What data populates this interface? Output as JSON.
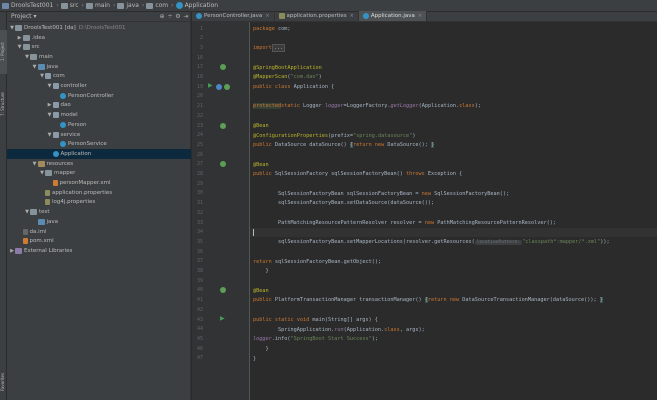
{
  "navbar": {
    "crumbs": [
      {
        "label": "DroolsTest001",
        "icon": "project-icon"
      },
      {
        "label": "src",
        "icon": "folder-icon"
      },
      {
        "label": "main",
        "icon": "folder-icon"
      },
      {
        "label": "java",
        "icon": "folder-icon"
      },
      {
        "label": "com",
        "icon": "folder-icon"
      },
      {
        "label": "Application",
        "icon": "class-icon"
      }
    ]
  },
  "left_strip": {
    "tabs": [
      {
        "label": "1: Project"
      },
      {
        "label": "7: Structure"
      },
      {
        "label": "Favorites"
      }
    ]
  },
  "project_panel": {
    "title": "Project",
    "dropdown_icon": "chevron-down-icon",
    "tools": [
      "⊕",
      "÷",
      "⚙",
      "⇥"
    ],
    "tree": [
      {
        "label": "DroolsTest001 [da]",
        "dim": "D:\\DroolsTest001",
        "depth": 0,
        "arrow": "▼",
        "icon": "folder"
      },
      {
        "label": ".idea",
        "depth": 1,
        "arrow": "▶",
        "icon": "folder"
      },
      {
        "label": "src",
        "depth": 1,
        "arrow": "▼",
        "icon": "folder"
      },
      {
        "label": "main",
        "depth": 2,
        "arrow": "▼",
        "icon": "folder"
      },
      {
        "label": "java",
        "depth": 3,
        "arrow": "▼",
        "icon": "src"
      },
      {
        "label": "com",
        "depth": 4,
        "arrow": "▼",
        "icon": "pkg"
      },
      {
        "label": "controller",
        "depth": 5,
        "arrow": "▼",
        "icon": "pkg"
      },
      {
        "label": "PersonController",
        "depth": 6,
        "arrow": "",
        "icon": "cls"
      },
      {
        "label": "dao",
        "depth": 5,
        "arrow": "▶",
        "icon": "pkg"
      },
      {
        "label": "model",
        "depth": 5,
        "arrow": "▼",
        "icon": "pkg"
      },
      {
        "label": "Person",
        "depth": 6,
        "arrow": "",
        "icon": "cls"
      },
      {
        "label": "service",
        "depth": 5,
        "arrow": "▼",
        "icon": "pkg"
      },
      {
        "label": "PersonService",
        "depth": 6,
        "arrow": "",
        "icon": "cls"
      },
      {
        "label": "Application",
        "depth": 5,
        "arrow": "",
        "icon": "cls",
        "selected": true
      },
      {
        "label": "resources",
        "depth": 3,
        "arrow": "▼",
        "icon": "res"
      },
      {
        "label": "mapper",
        "depth": 4,
        "arrow": "▼",
        "icon": "folder"
      },
      {
        "label": "personMapper.xml",
        "depth": 5,
        "arrow": "",
        "icon": "xml"
      },
      {
        "label": "application.properties",
        "depth": 4,
        "arrow": "",
        "icon": "props"
      },
      {
        "label": "log4j.properties",
        "depth": 4,
        "arrow": "",
        "icon": "props"
      },
      {
        "label": "test",
        "depth": 2,
        "arrow": "▼",
        "icon": "folder"
      },
      {
        "label": "java",
        "depth": 3,
        "arrow": "",
        "icon": "src"
      },
      {
        "label": "da.iml",
        "depth": 1,
        "arrow": "",
        "icon": "iml"
      },
      {
        "label": "pom.xml",
        "depth": 1,
        "arrow": "",
        "icon": "xml"
      },
      {
        "label": "External Libraries",
        "depth": 0,
        "arrow": "▶",
        "icon": "lib"
      }
    ]
  },
  "editor": {
    "tabs": [
      {
        "label": "PersonController.java",
        "icon": "class",
        "active": false
      },
      {
        "label": "application.properties",
        "icon": "props",
        "active": false
      },
      {
        "label": "Application.java",
        "icon": "class",
        "active": true
      }
    ],
    "close_glyph": "×",
    "line_numbers": [
      "1",
      "2",
      "3",
      "16",
      "17",
      "18",
      "19",
      "20",
      "21",
      "22",
      "23",
      "24",
      "25",
      "26",
      "27",
      "28",
      "29",
      "30",
      "31",
      "32",
      "33",
      "34",
      "35",
      "36",
      "37",
      "38",
      "39",
      "40",
      "41",
      "42",
      "43",
      "44",
      "45",
      "46",
      "47",
      "48",
      "49",
      "50",
      "51",
      "52",
      "53"
    ],
    "lines": [
      {
        "n": "1",
        "html": "<span class=\"kw\">package</span> com;"
      },
      {
        "n": "2",
        "html": ""
      },
      {
        "n": "3",
        "html": "<span class=\"kw\">import</span> <span class=\"fold\">...</span>"
      },
      {
        "n": "16",
        "html": ""
      },
      {
        "n": "17",
        "html": "<span class=\"ann\">@SpringBootApplication</span>"
      },
      {
        "n": "18",
        "html": "<span class=\"ann\">@MapperScan</span>(<span class=\"str\">\"com.dao\"</span>)"
      },
      {
        "n": "19",
        "html": "<span class=\"kw\">public class</span> Application {"
      },
      {
        "n": "20",
        "html": ""
      },
      {
        "n": "21",
        "html": "    <span class=\"kw hl\">protected</span> <span class=\"kw\">static</span> Logger <span class=\"stat\">logger</span>=LoggerFactory.<span class=\"stat\">getLogger</span>(Application.<span class=\"kw\">class</span>);"
      },
      {
        "n": "22",
        "html": ""
      },
      {
        "n": "23",
        "html": "    <span class=\"ann\">@Bean</span>"
      },
      {
        "n": "24",
        "html": "    <span class=\"ann\">@ConfigurationProperties</span>(prefix=<span class=\"str\">\"spring.datasource\"</span>)"
      },
      {
        "n": "25",
        "html": "    <span class=\"kw\">public</span> DataSource dataSource() <span class=\"brace-hl\">{</span> <span class=\"kw\">return new</span> DataSource(); <span class=\"brace-hl\">}</span>"
      },
      {
        "n": "26",
        "html": ""
      },
      {
        "n": "27",
        "html": "    <span class=\"ann\">@Bean</span>"
      },
      {
        "n": "28",
        "html": "    <span class=\"kw\">public</span> SqlSessionFactory sqlSessionFactoryBean() <span class=\"kw\">throws</span> Exception {"
      },
      {
        "n": "29",
        "html": ""
      },
      {
        "n": "30",
        "html": "        SqlSessionFactoryBean sqlSessionFactoryBean = <span class=\"kw\">new</span> SqlSessionFactoryBean();"
      },
      {
        "n": "31",
        "html": "        sqlSessionFactoryBean.setDataSource(dataSource());"
      },
      {
        "n": "32",
        "html": ""
      },
      {
        "n": "33",
        "html": "        PathMatchingResourcePatternResolver resolver = <span class=\"kw\">new</span> PathMatchingResourcePatternResolver();"
      },
      {
        "n": "34",
        "html": "<span class=\"caret\"></span>",
        "current": true
      },
      {
        "n": "35",
        "html": "        sqlSessionFactoryBean.setMapperLocations(resolver.getResources(<span class=\"hint\">locationPattern:</span> <span class=\"str\">\"classpath*:mapper/*.xml\"</span>));"
      },
      {
        "n": "36",
        "html": ""
      },
      {
        "n": "37",
        "html": "        <span class=\"kw\">return</span> sqlSessionFactoryBean.getObject();"
      },
      {
        "n": "38",
        "html": "    }"
      },
      {
        "n": "39",
        "html": ""
      },
      {
        "n": "40",
        "html": "    <span class=\"ann\">@Bean</span>"
      },
      {
        "n": "41",
        "html": "    <span class=\"kw\">public</span> PlatformTransactionManager transactionManager() <span class=\"brace-hl\">{</span> <span class=\"kw\">return new</span> DataSourceTransactionManager(dataSource()); <span class=\"brace-hl\">}</span>"
      },
      {
        "n": "42",
        "html": ""
      },
      {
        "n": "43",
        "html": "    <span class=\"kw\">public static void</span> main(String[] args) {"
      },
      {
        "n": "44",
        "html": "        SpringApplication.<span class=\"stat\">run</span>(Application.<span class=\"kw\">class</span>, args);"
      },
      {
        "n": "45",
        "html": "        <span class=\"stat\">logger</span>.info(<span class=\"str\">\"SpringBoot Start Success\"</span>);"
      },
      {
        "n": "46",
        "html": "    }"
      },
      {
        "n": "47",
        "html": "}"
      }
    ]
  },
  "colors": {
    "background": "#2b2b2b",
    "panel": "#3c3f41",
    "selection": "#0d293e",
    "keyword": "#cc7832",
    "annotation": "#bbb529",
    "string": "#6a8759"
  }
}
